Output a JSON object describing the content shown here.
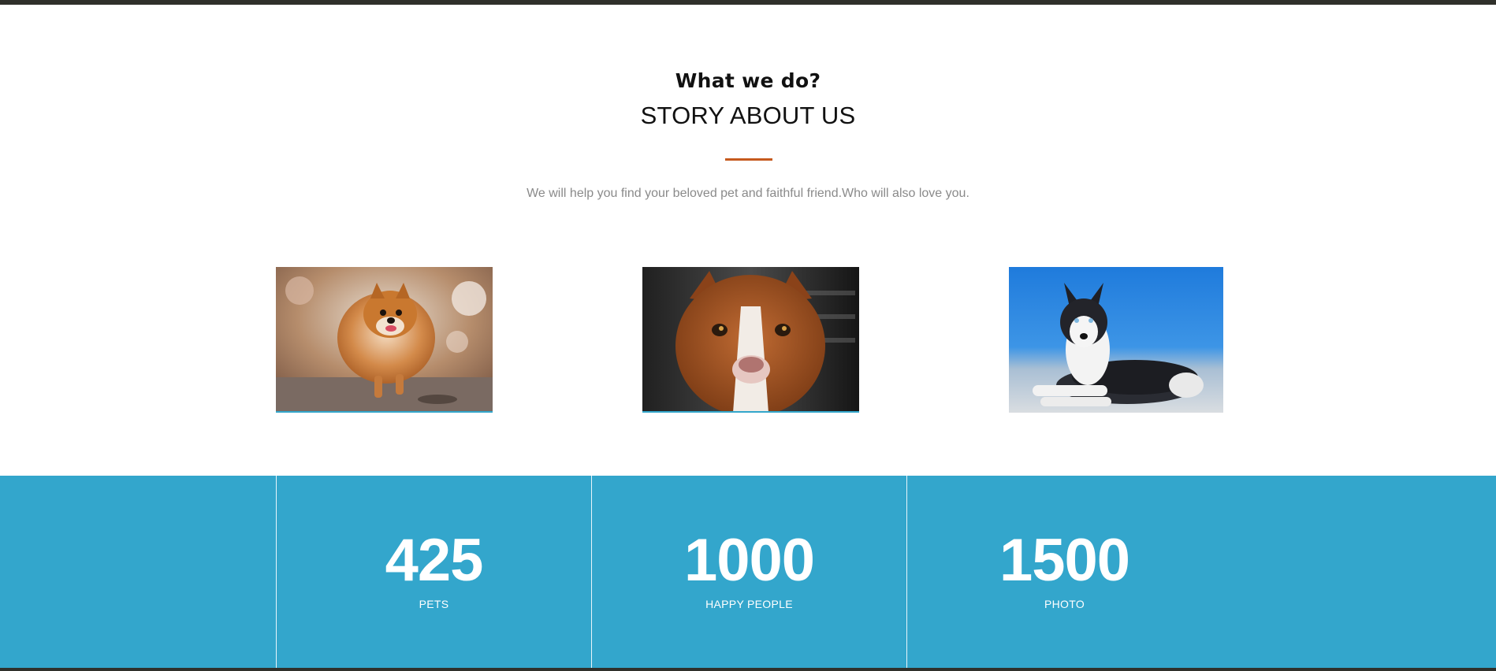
{
  "section": {
    "eyebrow": "What we do?",
    "title": "STORY ABOUT US",
    "subtitle": "We will help you find your beloved pet and faithful friend.Who will also love you."
  },
  "gallery": [
    {
      "subject": "pomeranian-photo"
    },
    {
      "subject": "pitbull-photo"
    },
    {
      "subject": "husky-photo"
    }
  ],
  "stats": [
    {
      "number": "425",
      "label": "PETS"
    },
    {
      "number": "1000",
      "label": "HAPPY PEOPLE"
    },
    {
      "number": "1500",
      "label": "PHOTO"
    }
  ],
  "colors": {
    "accent": "#c65a1e",
    "stats_background": "#33a6cc",
    "dark_strip": "#2f302b"
  }
}
